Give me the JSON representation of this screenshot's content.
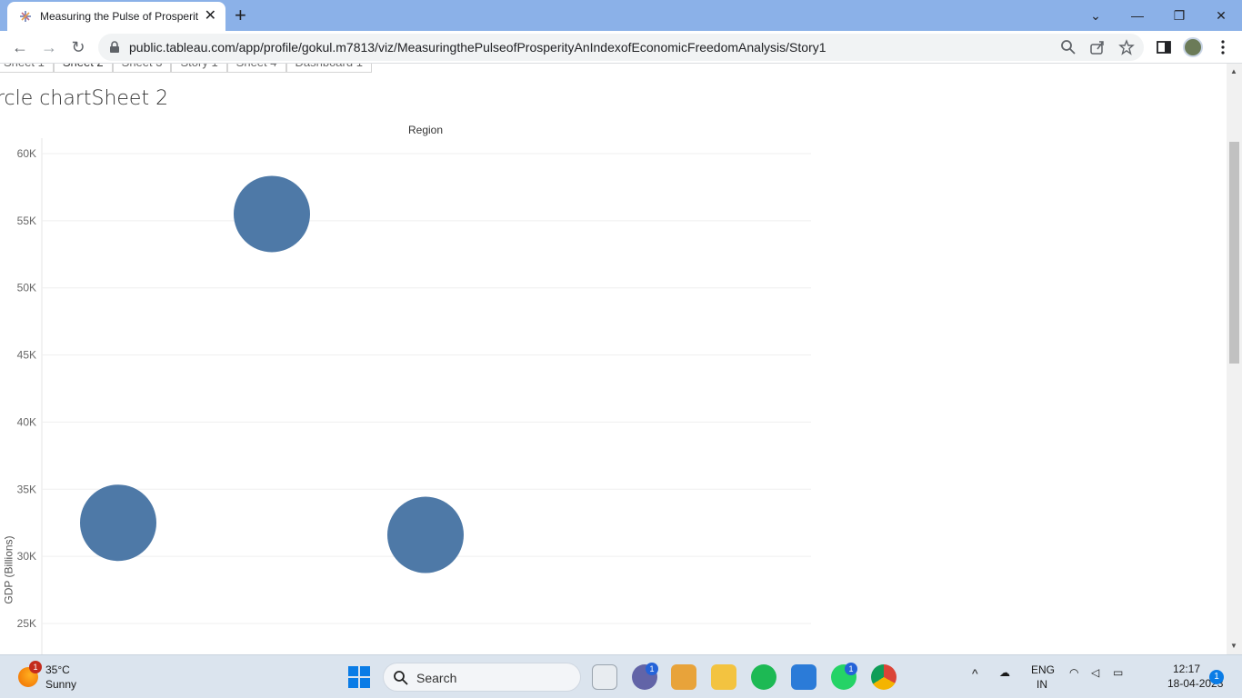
{
  "browser": {
    "tab_title": "Measuring the Pulse of Prosperit",
    "url": "public.tableau.com/app/profile/gokul.m7813/viz/MeasuringthePulseofProsperityAnIndexofEconomicFreedomAnalysis/Story1"
  },
  "story": {
    "tabs": [
      "Sheet 1",
      "Sheet 2",
      "Sheet 3",
      "Story 1",
      "Sheet 4",
      "Dashboard 1"
    ],
    "active_tab": "Sheet 2",
    "sheet_title": "rcle chartSheet 2",
    "column_header": "Region",
    "y_axis_title": "GDP (Billions)"
  },
  "chart_data": {
    "type": "scatter",
    "title": "",
    "xlabel": "Region",
    "ylabel": "GDP (Billions)",
    "ylim": [
      24000,
      61000
    ],
    "y_ticks": [
      "25K",
      "30K",
      "35K",
      "40K",
      "45K",
      "50K",
      "55K",
      "60K"
    ],
    "y_tick_values": [
      25000,
      30000,
      35000,
      40000,
      45000,
      50000,
      55000,
      60000
    ],
    "grid": true,
    "points": [
      {
        "y": 32500
      },
      {
        "y": 55500
      },
      {
        "y": 31600
      }
    ],
    "mark_color": "#4e79a7"
  },
  "taskbar": {
    "weather_temp": "35°C",
    "weather_cond": "Sunny",
    "weather_badge": "1",
    "search_label": "Search",
    "teams_badge": "1",
    "whatsapp_badge": "1",
    "lang": "ENG",
    "region": "IN",
    "time": "12:17",
    "date": "18-04-2023",
    "notif_count": "1"
  }
}
